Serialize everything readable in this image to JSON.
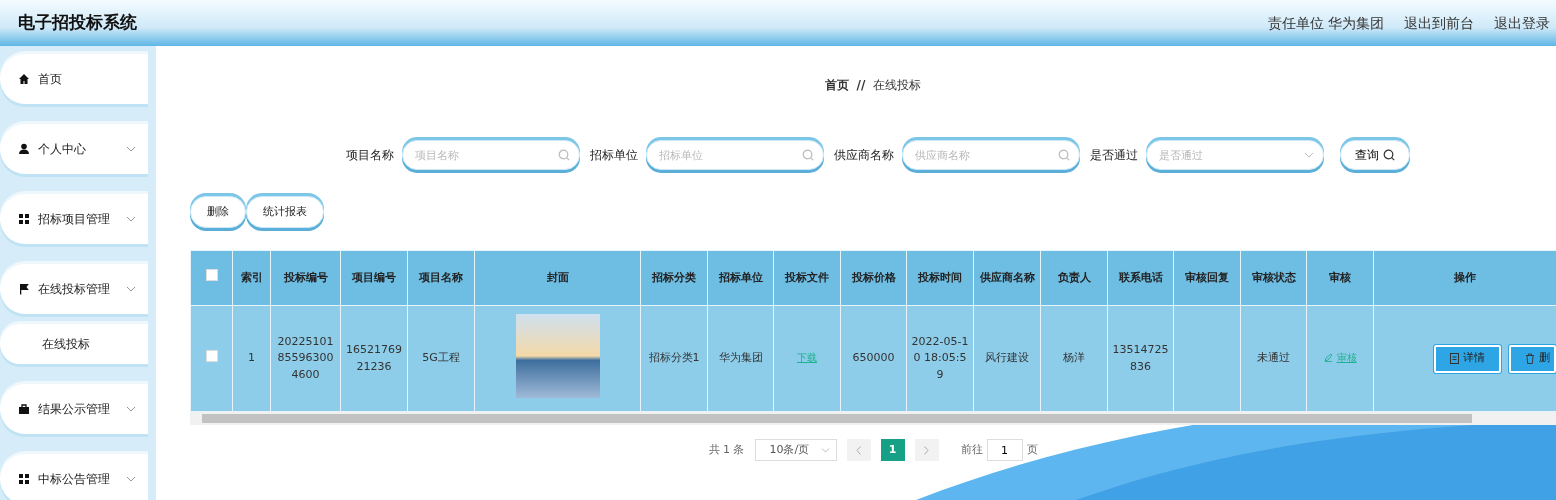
{
  "header": {
    "title": "电子招投标系统",
    "links": [
      "责任单位 华为集团",
      "退出到前台",
      "退出登录"
    ]
  },
  "sidebar": {
    "items": [
      {
        "kind": "link",
        "label": "首页"
      },
      {
        "kind": "menu",
        "label": "个人中心"
      },
      {
        "kind": "menu",
        "label": "招标项目管理"
      },
      {
        "kind": "menu",
        "label": "在线投标管理",
        "children": [
          {
            "label": "在线投标"
          }
        ]
      },
      {
        "kind": "menu",
        "label": "结果公示管理"
      },
      {
        "kind": "menu",
        "label": "中标公告管理"
      }
    ]
  },
  "breadcrumb": {
    "home": "首页",
    "separator": "//",
    "current": "在线投标"
  },
  "filters": [
    {
      "kind": "text",
      "label": "项目名称",
      "placeholder": "项目名称"
    },
    {
      "kind": "text",
      "label": "招标单位",
      "placeholder": "招标单位"
    },
    {
      "kind": "text",
      "label": "供应商名称",
      "placeholder": "供应商名称"
    },
    {
      "kind": "select",
      "label": "是否通过",
      "placeholder": "是否通过"
    }
  ],
  "search_button": "查询",
  "actions": [
    "删除",
    "统计报表"
  ],
  "table": {
    "select_all_checked": false,
    "columns": [
      "索引",
      "投标编号",
      "项目编号",
      "项目名称",
      "封面",
      "招标分类",
      "招标单位",
      "投标文件",
      "投标价格",
      "投标时间",
      "供应商名称",
      "负责人",
      "联系电话",
      "审核回复",
      "审核状态",
      "审核",
      "操作"
    ],
    "rows": [
      {
        "checked": false,
        "cells": [
          {
            "kind": "text",
            "text": "1"
          },
          {
            "kind": "text",
            "text": "20225101855963004600"
          },
          {
            "kind": "text",
            "text": "1652176921236"
          },
          {
            "kind": "text",
            "text": "5G工程"
          },
          {
            "kind": "image"
          },
          {
            "kind": "text",
            "text": "招标分类1"
          },
          {
            "kind": "text",
            "text": "华为集团"
          },
          {
            "kind": "link",
            "text": "下载"
          },
          {
            "kind": "text",
            "text": "650000"
          },
          {
            "kind": "text",
            "text": "2022-05-10 18:05:59"
          },
          {
            "kind": "text",
            "text": "风行建设"
          },
          {
            "kind": "text",
            "text": "杨洋"
          },
          {
            "kind": "text",
            "text": "13514725836"
          },
          {
            "kind": "text",
            "text": ""
          },
          {
            "kind": "text",
            "text": "未通过"
          },
          {
            "kind": "edit_link",
            "text": "审核"
          },
          {
            "kind": "buttons",
            "buttons": [
              {
                "kind": "details",
                "text": "详情"
              },
              {
                "kind": "delete",
                "text": "删"
              }
            ]
          }
        ]
      }
    ]
  },
  "pagination": {
    "total": "共 1 条",
    "page_size": "10条/页",
    "pages": [
      {
        "label": "1",
        "selected": true
      }
    ],
    "goto_label": "前往",
    "goto_value": "1",
    "goto_suffix": "页"
  }
}
